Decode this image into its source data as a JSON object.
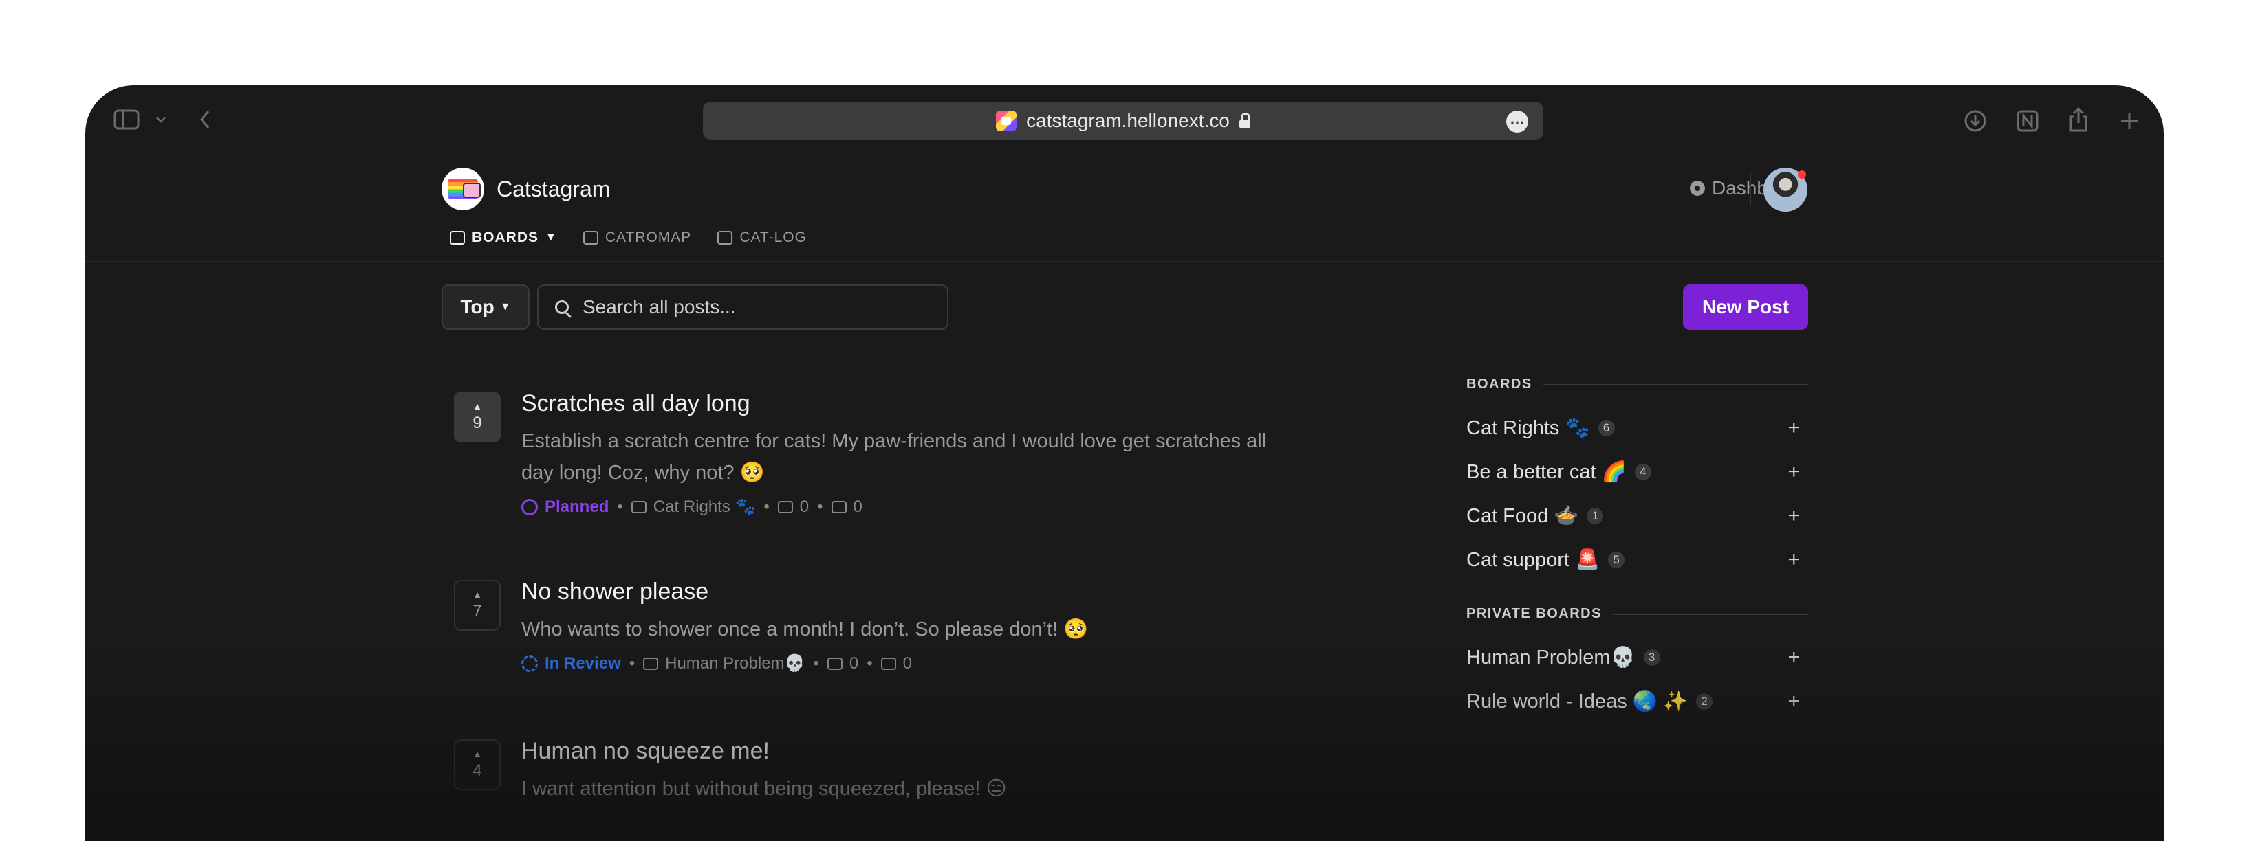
{
  "browser": {
    "url": "catstagram.hellonext.co"
  },
  "app": {
    "name": "Catstagram",
    "dashboard_label": "Dashboard",
    "nav": [
      {
        "label": "BOARDS",
        "active": true
      },
      {
        "label": "CATROMAP",
        "active": false
      },
      {
        "label": "CAT-LOG",
        "active": false
      }
    ]
  },
  "filters": {
    "sort_label": "Top",
    "search_placeholder": "Search all posts...",
    "new_post_label": "New Post"
  },
  "posts": [
    {
      "votes": "9",
      "title": "Scratches all day long",
      "description": "Establish a scratch centre for cats! My paw-friends and I would love get scratches all day long! Coz, why not? 🥺",
      "status": "Planned",
      "board": "Cat Rights 🐾",
      "comments": "0",
      "replies": "0"
    },
    {
      "votes": "7",
      "title": "No shower please",
      "description": "Who wants to shower once a month! I don’t. So please don’t! 🥺",
      "status": "In Review",
      "board": "Human Problem💀",
      "comments": "0",
      "replies": "0"
    },
    {
      "votes": "4",
      "title": "Human no squeeze me!",
      "description": "I want attention but without being squeezed, please! 😑"
    }
  ],
  "sidebar": {
    "boards_heading": "BOARDS",
    "boards": [
      {
        "name": "Cat Rights 🐾",
        "count": "6"
      },
      {
        "name": "Be a better cat 🌈",
        "count": "4"
      },
      {
        "name": "Cat Food 🍲",
        "count": "1"
      },
      {
        "name": "Cat support 🚨",
        "count": "5"
      }
    ],
    "private_heading": "PRIVATE BOARDS",
    "private_boards": [
      {
        "name": "Human Problem💀",
        "count": "3"
      },
      {
        "name": "Rule world - Ideas 🌏 ✨",
        "count": "2"
      }
    ]
  },
  "colors": {
    "accent": "#7b22d6",
    "planned": "#8b3fe6",
    "in_review": "#2f6fe0"
  }
}
